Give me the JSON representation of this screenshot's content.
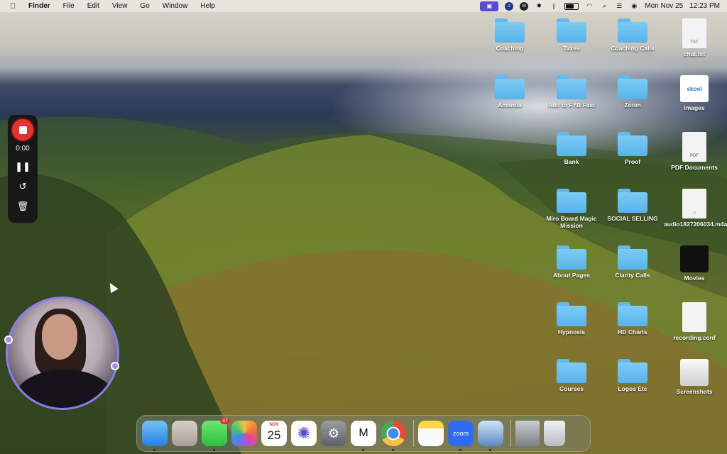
{
  "menubar": {
    "apple_icon": "apple-logo",
    "items": [
      "Finder",
      "File",
      "Edit",
      "View",
      "Go",
      "Window",
      "Help"
    ],
    "date": "Mon Nov 25",
    "time": "12:23 PM",
    "status_icons": [
      "screen-recorder-icon",
      "zoom-icon",
      "miro-icon",
      "gear-icon",
      "bluetooth-icon",
      "battery-icon",
      "wifi-icon",
      "search-icon",
      "control-center-icon",
      "siri-icon"
    ]
  },
  "recorder": {
    "time": "0:00",
    "pause_icon": "❚❚",
    "restart_icon": "↺",
    "delete_icon": "🗑"
  },
  "desktop": {
    "icons": [
      {
        "label": "Coaching",
        "kind": "folder"
      },
      {
        "label": "Taxes",
        "kind": "folder"
      },
      {
        "label": "Coaching Calls",
        "kind": "folder"
      },
      {
        "label": "chat.txt",
        "kind": "file",
        "tag": "TXT"
      },
      {
        "label": "Amanda",
        "kind": "folder"
      },
      {
        "label": "Add to FYB Fast",
        "kind": "folder"
      },
      {
        "label": "Zoom",
        "kind": "folder"
      },
      {
        "label": "Images",
        "kind": "thumb",
        "tag": "skool"
      },
      {
        "label": "Bank",
        "kind": "folder"
      },
      {
        "label": "Proof",
        "kind": "folder"
      },
      {
        "label": "PDF Documents",
        "kind": "file",
        "tag": "PDF"
      },
      {
        "label": "Miro Board Magic Mission",
        "kind": "folder"
      },
      {
        "label": "SOCIAL SELLING",
        "kind": "folder"
      },
      {
        "label": "audio1827206034.m4a",
        "kind": "file",
        "tag": "♫"
      },
      {
        "label": "About Pages",
        "kind": "folder"
      },
      {
        "label": "Clarity Calls",
        "kind": "folder"
      },
      {
        "label": "Movies",
        "kind": "thumb"
      },
      {
        "label": "Hypnosis",
        "kind": "folder"
      },
      {
        "label": "HD Charts",
        "kind": "folder"
      },
      {
        "label": "recording.conf",
        "kind": "file"
      },
      {
        "label": "Courses",
        "kind": "folder"
      },
      {
        "label": "Logos Etc",
        "kind": "folder"
      },
      {
        "label": "Screenshots",
        "kind": "thumb"
      }
    ]
  },
  "dock": {
    "messages_badge": "47",
    "calendar_month": "NOV",
    "calendar_day": "25",
    "zoom_label": "zoom"
  }
}
